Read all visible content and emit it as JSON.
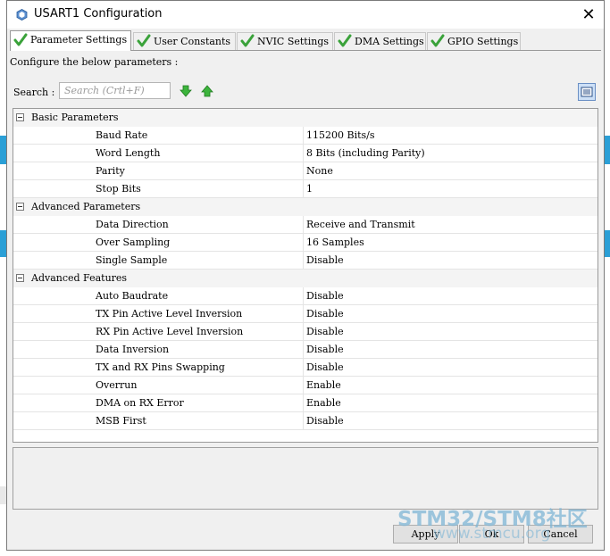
{
  "window": {
    "title": "USART1 Configuration",
    "close_glyph": "✕"
  },
  "tabs": [
    {
      "label": "Parameter Settings",
      "active": true,
      "icon": "check-icon"
    },
    {
      "label": "User Constants",
      "active": false,
      "icon": "check-icon"
    },
    {
      "label": "NVIC Settings",
      "active": false,
      "icon": "check-icon"
    },
    {
      "label": "DMA Settings",
      "active": false,
      "icon": "check-icon"
    },
    {
      "label": "GPIO Settings",
      "active": false,
      "icon": "check-icon"
    }
  ],
  "panel": {
    "configure_label": "Configure the below parameters :",
    "search_label": "Search :",
    "search_placeholder": "Search (Crtl+F)"
  },
  "groups": [
    {
      "label": "Basic Parameters",
      "params": [
        {
          "name": "Baud Rate",
          "value": "115200 Bits/s"
        },
        {
          "name": "Word Length",
          "value": "8 Bits (including Parity)"
        },
        {
          "name": "Parity",
          "value": "None"
        },
        {
          "name": "Stop Bits",
          "value": "1"
        }
      ]
    },
    {
      "label": "Advanced Parameters",
      "params": [
        {
          "name": "Data Direction",
          "value": "Receive and Transmit"
        },
        {
          "name": "Over Sampling",
          "value": "16 Samples"
        },
        {
          "name": "Single Sample",
          "value": "Disable"
        }
      ]
    },
    {
      "label": "Advanced Features",
      "params": [
        {
          "name": "Auto Baudrate",
          "value": "Disable"
        },
        {
          "name": "TX Pin Active Level Inversion",
          "value": "Disable"
        },
        {
          "name": "RX Pin Active Level Inversion",
          "value": "Disable"
        },
        {
          "name": "Data Inversion",
          "value": "Disable"
        },
        {
          "name": "TX and RX Pins Swapping",
          "value": "Disable"
        },
        {
          "name": "Overrun",
          "value": "Enable"
        },
        {
          "name": "DMA on RX Error",
          "value": "Enable"
        },
        {
          "name": "MSB First",
          "value": "Disable"
        }
      ]
    }
  ],
  "buttons": {
    "apply": "Apply",
    "ok": "Ok",
    "cancel": "Cancel"
  },
  "watermark": {
    "brand": "STM32/STM8社区",
    "url": "www.stmcu.org"
  },
  "colors": {
    "check_green": "#3aa23a",
    "arrow_green": "#3cb43c",
    "watermark": "#7fb6d6"
  }
}
